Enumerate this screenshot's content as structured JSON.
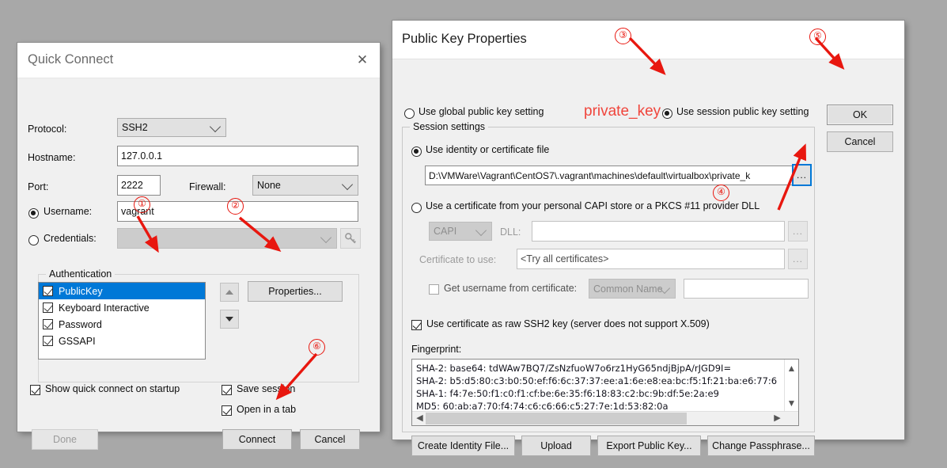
{
  "quick_connect": {
    "title": "Quick Connect",
    "close_icon": "close-icon",
    "protocol_label": "Protocol:",
    "protocol_value": "SSH2",
    "hostname_label": "Hostname:",
    "hostname_value": "127.0.0.1",
    "port_label": "Port:",
    "port_value": "2222",
    "firewall_label": "Firewall:",
    "firewall_value": "None",
    "username_label": "Username:",
    "username_value": "vagrant",
    "credentials_label": "Credentials:",
    "credentials_value": "",
    "key_icon": "key-icon",
    "authentication_group": "Authentication",
    "auth_items": [
      {
        "label": "PublicKey",
        "checked": true,
        "selected": true
      },
      {
        "label": "Keyboard Interactive",
        "checked": true,
        "selected": false
      },
      {
        "label": "Password",
        "checked": true,
        "selected": false
      },
      {
        "label": "GSSAPI",
        "checked": true,
        "selected": false
      }
    ],
    "move_up_icon": "arrow-up-icon",
    "move_down_icon": "arrow-down-icon",
    "properties_button": "Properties...",
    "show_on_startup_label": "Show quick connect on startup",
    "show_on_startup_checked": true,
    "save_session_label": "Save session",
    "save_session_checked": true,
    "open_in_tab_label": "Open in a tab",
    "open_in_tab_checked": true,
    "done_button": "Done",
    "connect_button": "Connect",
    "cancel_button": "Cancel"
  },
  "public_key": {
    "title": "Public Key Properties",
    "use_global_label": "Use global public key setting",
    "use_global_selected": false,
    "use_session_label": "Use session public key setting",
    "use_session_selected": true,
    "ok_button": "OK",
    "cancel_button": "Cancel",
    "session_settings_group": "Session settings",
    "use_identity_label": "Use identity or certificate file",
    "use_identity_selected": true,
    "identity_path": "D:\\VMWare\\Vagrant\\CentOS7\\.vagrant\\machines\\default\\virtualbox\\private_k",
    "browse_identity_button": "...",
    "use_capi_label": "Use a certificate from your personal CAPI store or a PKCS #11 provider DLL",
    "use_capi_selected": false,
    "capi_value": "CAPI",
    "dll_label": "DLL:",
    "dll_value": "",
    "browse_dll_button": "...",
    "certificate_to_use_label": "Certificate to use:",
    "certificate_to_use_value": "<Try all certificates>",
    "browse_cert_button": "...",
    "get_username_label": "Get username from certificate:",
    "get_username_checked": false,
    "common_name_value": "Common Name",
    "username_from_cert_value": "",
    "raw_ssh2_label": "Use certificate as raw SSH2 key (server does not support X.509)",
    "raw_ssh2_checked": true,
    "fingerprint_label": "Fingerprint:",
    "fingerprint_lines": [
      "SHA-2: base64: tdWAw7BQ7/ZsNzfuoW7o6rz1HyG65ndjBjpA/rJGD9I=",
      "SHA-2: b5:d5:80:c3:b0:50:ef:f6:6c:37:37:ee:a1:6e:e8:ea:bc:f5:1f:21:ba:e6:77:6",
      "SHA-1: f4:7e:50:f1:c0:f1:cf:be:6e:35:f6:18:83:c2:bc:9b:df:5e:2a:e9",
      "MD5: 60:ab:a7:70:f4:74:c6:c6:66:c5:27:7e:1d:53:82:0a"
    ],
    "scroll_up_icon": "chevron-up-icon",
    "scroll_down_icon": "chevron-down-icon",
    "scroll_left_icon": "chevron-left-icon",
    "scroll_right_icon": "chevron-right-icon",
    "create_identity_button": "Create Identity File...",
    "upload_button": "Upload",
    "export_public_key_button": "Export Public Key...",
    "change_passphrase_button": "Change Passphrase..."
  },
  "annotations": {
    "marker_1": "①",
    "marker_2": "②",
    "marker_3": "③",
    "marker_4": "④",
    "marker_5": "⑤",
    "marker_6": "⑥",
    "private_key_note": "private_key",
    "color": "#e8170f"
  }
}
